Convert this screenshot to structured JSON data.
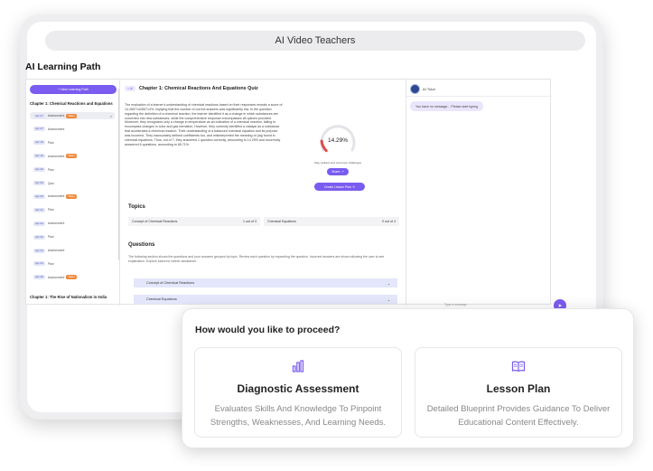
{
  "window": {
    "title": "AI Video Teachers"
  },
  "page": {
    "title": "AI Learning Path"
  },
  "sidebar": {
    "new_button": "+ New Learning Path",
    "chapter1": "Chapter 1: Chemical Reactions and Equations",
    "items": [
      {
        "date": "Apr 27",
        "label": "Assessment",
        "badge": "Taken",
        "selected": true
      },
      {
        "date": "Apr 27",
        "label": "Assessment",
        "badge": ""
      },
      {
        "date": "Apr 19",
        "label": "Plan",
        "badge": ""
      },
      {
        "date": "Apr 19",
        "label": "Assessment",
        "badge": "Taken"
      },
      {
        "date": "Apr 20",
        "label": "Plan",
        "badge": ""
      },
      {
        "date": "Apr 20",
        "label": "Quiz",
        "badge": ""
      },
      {
        "date": "Apr 20",
        "label": "Assessment",
        "badge": "Taken"
      },
      {
        "date": "Apr 21",
        "label": "Plan",
        "badge": ""
      },
      {
        "date": "Apr 22",
        "label": "Assessment",
        "badge": ""
      },
      {
        "date": "Apr 22",
        "label": "Plan",
        "badge": ""
      },
      {
        "date": "Apr 24",
        "label": "Assessment",
        "badge": ""
      },
      {
        "date": "Apr 24",
        "label": "Plan",
        "badge": ""
      },
      {
        "date": "Apr 26",
        "label": "Assessment",
        "badge": "Taken"
      }
    ],
    "chapter2": "Chapter 1: The Rise of Nationalism in India"
  },
  "quiz": {
    "ai_chip": "< AI",
    "title": "Chapter 1: Chemical Reactions And Equations Quiz",
    "summary": "The evaluation of a learner's understanding of chemical reactions based on their responses reveals a score of 14.285714285714%, implying that the number of correct answers was significantly low. In the question regarding the definition of a chemical reaction, the learner identified it as a change in which substances are converted into new substances, while the comprehensive response encompasses all options provided. Moreover, they recognized only a change in temperature as an indication of a chemical reaction, failing to encompass changes in color and gas formation. However, they correctly identified a catalyst as a substance that accelerates a chemical reaction. Their understanding of a balanced chemical equation and its purpose was incorrect. They inaccurately defined coefficients too, and misinterpreted the meaning of (aq) found in chemical equations. Thus, out of 7, they answered 1 question correctly, amounting to 14.29% and incorrectly answered 6 questions, amounting to 85.71%.",
    "score_text": "14.29%",
    "score_value": 14.29,
    "gauge_caption": "Stay resilient and overcome challenges",
    "share_button": "Share",
    "lesson_button": "Create Lesson Plan",
    "topics_heading": "Topics",
    "topics": [
      {
        "name": "Concept of Chemical Reactions",
        "score": "1 out of 3"
      },
      {
        "name": "Chemical Equations",
        "score": "0 out of 4"
      }
    ],
    "questions_heading": "Questions",
    "questions_text": "The following section shows the questions and your answers grouped by topic. Review each question by expanding the question. Incorrect answers are shown allowing the user to see explanation. Explore tutors for further assistance.",
    "accordions": [
      "Concept of Chemical Reactions",
      "Chemical Equations"
    ]
  },
  "tutor": {
    "name": "AI Tutor",
    "message": "You have no message... Please start typing",
    "input_placeholder": "Type a message"
  },
  "popup": {
    "title": "How would you like to proceed?",
    "options": [
      {
        "title": "Diagnostic Assessment",
        "description": "Evaluates Skills And Knowledge To Pinpoint Strengths, Weaknesses, And Learning Needs."
      },
      {
        "title": "Lesson Plan",
        "description": "Detailed Blueprint Provides Guidance To Deliver Educational Content Effectively."
      }
    ]
  },
  "colors": {
    "accent": "#7a5cf0",
    "badge": "#f08a3c",
    "gauge_fill": "#e04a4a",
    "gauge_track": "#e3e3e8"
  }
}
